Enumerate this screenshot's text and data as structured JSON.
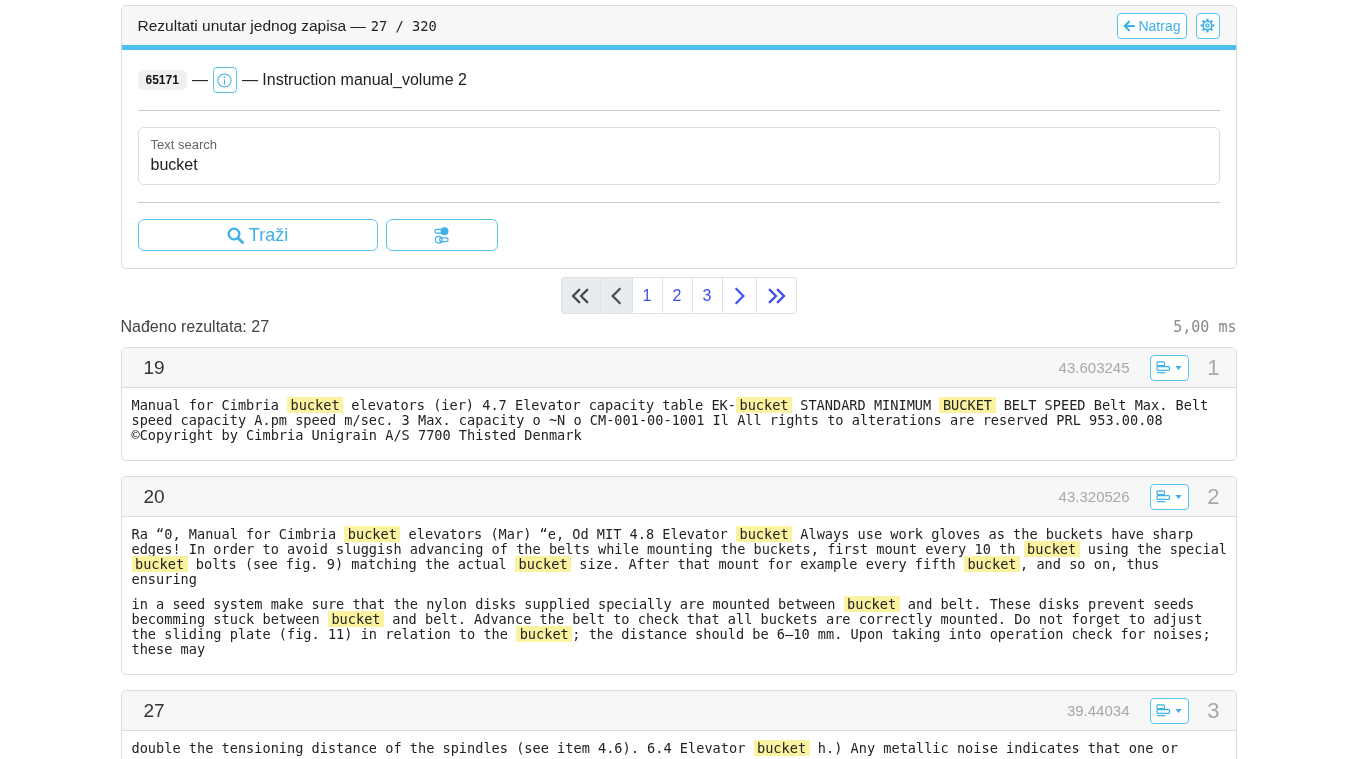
{
  "header": {
    "title": "Rezultati unutar jednog zapisa —",
    "counter": "27 / 320",
    "back_button": "Natrag"
  },
  "record": {
    "badge": "65171",
    "separator": "—",
    "title": "— Instruction manual_volume 2"
  },
  "search": {
    "label": "Text search",
    "value": "bucket",
    "submit_button": "Traži"
  },
  "pagination": [
    {
      "kind": "first",
      "disabled": true,
      "selected": false
    },
    {
      "kind": "prev",
      "disabled": true,
      "selected": false
    },
    {
      "kind": "page",
      "label": "1",
      "disabled": false,
      "selected": false
    },
    {
      "kind": "page",
      "label": "2",
      "disabled": false,
      "selected": false
    },
    {
      "kind": "page",
      "label": "3",
      "disabled": false,
      "selected": false
    },
    {
      "kind": "next",
      "disabled": false,
      "selected": false
    },
    {
      "kind": "last",
      "disabled": false,
      "selected": false
    }
  ],
  "summary": {
    "found": "Nađeno rezultata: 27",
    "time": "5,00 ms"
  },
  "results": [
    {
      "number": "19",
      "score": "43.603245",
      "rank": "1",
      "paragraphs": [
        [
          {
            "text": "Manual for Cimbria ",
            "highlight": false
          },
          {
            "text": "bucket",
            "highlight": true
          },
          {
            "text": " elevators (ier) 4.7 Elevator capacity table EK-",
            "highlight": false
          },
          {
            "text": "bucket",
            "highlight": true
          },
          {
            "text": " STANDARD MINIMUM ",
            "highlight": false
          },
          {
            "text": "BUCKET",
            "highlight": true
          },
          {
            "text": " BELT SPEED Belt Max. Belt speed capacity A.pm speed m/sec. 3 Max. capacity o ~N o CM-001-00-1001 Il All rights to alterations are reserved PRL 953.00.08 ©Copyright by Cimbria Unigrain A/S 7700 Thisted Denmark",
            "highlight": false
          }
        ]
      ]
    },
    {
      "number": "20",
      "score": "43.320526",
      "rank": "2",
      "paragraphs": [
        [
          {
            "text": "Ra “0, Manual for Cimbria ",
            "highlight": false
          },
          {
            "text": "bucket",
            "highlight": true
          },
          {
            "text": " elevators (Mar) “e, Od MIT 4.8 Elevator ",
            "highlight": false
          },
          {
            "text": "bucket",
            "highlight": true
          },
          {
            "text": " Always use work gloves as the buckets have sharp edges! In order to avoid sluggish advancing of the belts while mounting the buckets, first mount every 10 th ",
            "highlight": false
          },
          {
            "text": "bucket",
            "highlight": true
          },
          {
            "text": " using the special ",
            "highlight": false
          },
          {
            "text": "bucket",
            "highlight": true
          },
          {
            "text": " bolts (see fig. 9) matching the actual ",
            "highlight": false
          },
          {
            "text": "bucket",
            "highlight": true
          },
          {
            "text": " size. After that mount for example every fifth ",
            "highlight": false
          },
          {
            "text": "bucket",
            "highlight": true
          },
          {
            "text": ", and so on, thus ensuring",
            "highlight": false
          }
        ],
        [
          {
            "text": "in a seed system make sure that the nylon disks supplied specially are mounted between ",
            "highlight": false
          },
          {
            "text": "bucket",
            "highlight": true
          },
          {
            "text": " and belt. These disks prevent seeds becomming stuck between ",
            "highlight": false
          },
          {
            "text": "bucket",
            "highlight": true
          },
          {
            "text": " and belt. Advance the belt to check that all buckets are correctly mounted. Do not forget to adjust the sliding plate (fig. 11) in relation to the ",
            "highlight": false
          },
          {
            "text": "bucket",
            "highlight": true
          },
          {
            "text": "; the distance should be 6–10 mm. Upon taking into operation check for noises; these may",
            "highlight": false
          }
        ]
      ]
    },
    {
      "number": "27",
      "score": "39.44034",
      "rank": "3",
      "paragraphs": [
        [
          {
            "text": "double the tensioning distance of the spindles (see item 4.6). 6.4 Elevator ",
            "highlight": false
          },
          {
            "text": "bucket",
            "highlight": true
          },
          {
            "text": " h.) Any metallic noise indicates that one or",
            "highlight": false
          }
        ]
      ]
    }
  ]
}
